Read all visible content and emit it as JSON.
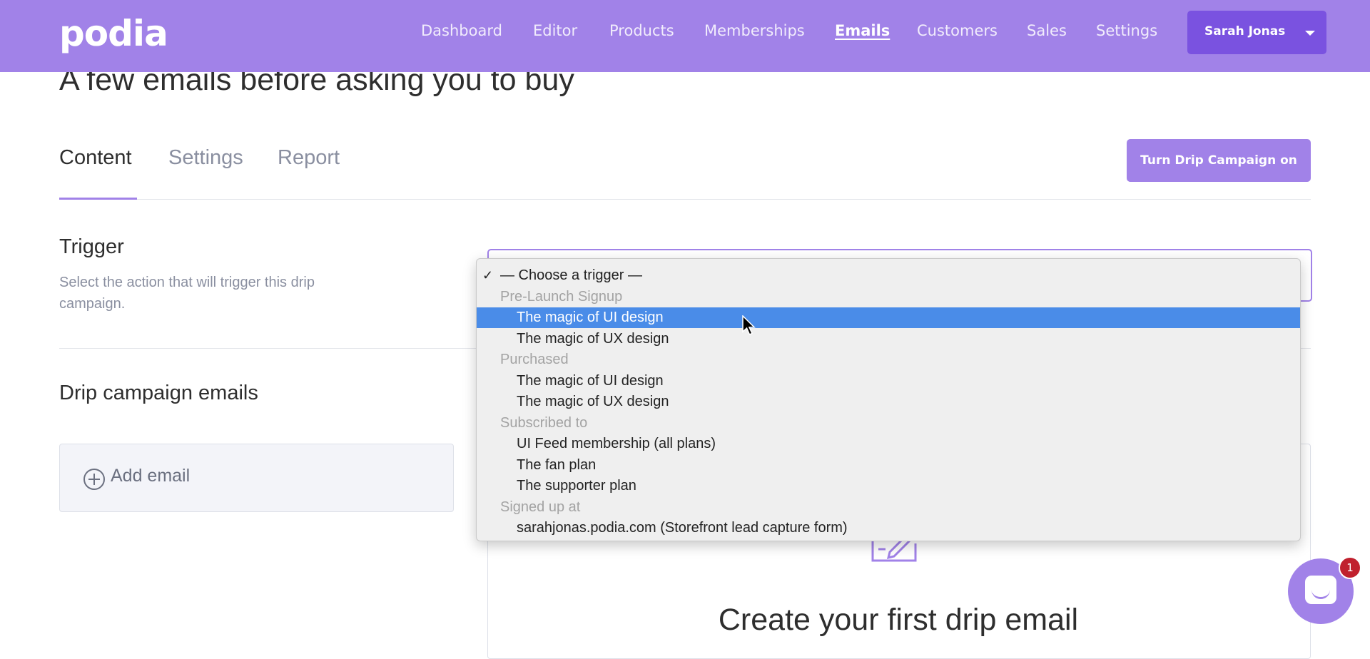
{
  "brand": {
    "logo": "podia",
    "accent": "#a182e8"
  },
  "nav": {
    "items": [
      "Dashboard",
      "Editor",
      "Products",
      "Memberships",
      "Emails",
      "Customers",
      "Sales",
      "Settings"
    ],
    "active": "Emails",
    "user": "Sarah Jonas"
  },
  "page": {
    "title": "A few emails before asking you to buy",
    "tabs": [
      "Content",
      "Settings",
      "Report"
    ],
    "active_tab": "Content",
    "turn_on_button": "Turn Drip Campaign on"
  },
  "trigger": {
    "heading": "Trigger",
    "description": "Select the action that will trigger this drip campaign.",
    "dropdown": {
      "check_mark": "✓",
      "placeholder": "— Choose a trigger —",
      "options": [
        {
          "label": "— Choose a trigger —",
          "kind": "option",
          "checked": true
        },
        {
          "label": "Pre-Launch Signup",
          "kind": "group"
        },
        {
          "label": "The magic of UI design",
          "kind": "option",
          "highlighted": true
        },
        {
          "label": "The magic of UX design",
          "kind": "option"
        },
        {
          "label": "Purchased",
          "kind": "group"
        },
        {
          "label": "The magic of UI design",
          "kind": "option"
        },
        {
          "label": "The magic of UX design",
          "kind": "option"
        },
        {
          "label": "Subscribed to",
          "kind": "group"
        },
        {
          "label": "UI Feed membership (all plans)",
          "kind": "option"
        },
        {
          "label": "The fan plan",
          "kind": "option"
        },
        {
          "label": "The supporter plan",
          "kind": "option"
        },
        {
          "label": "Signed up at",
          "kind": "group"
        },
        {
          "label": "sarahjonas.podia.com (Storefront lead capture form)",
          "kind": "option"
        }
      ]
    }
  },
  "drip": {
    "heading": "Drip campaign emails",
    "add_email": "Add email",
    "empty_title": "Create your first drip email"
  },
  "chat": {
    "badge_count": "1"
  }
}
